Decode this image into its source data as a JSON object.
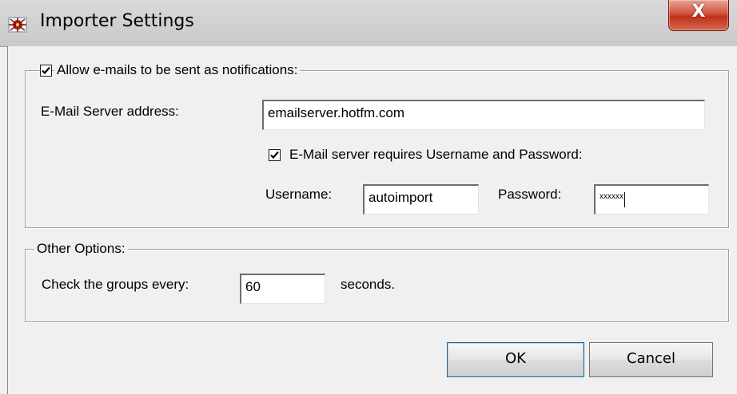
{
  "window": {
    "title": "Importer Settings",
    "close_glyph": "X",
    "icon": "importer-app-icon"
  },
  "notifications": {
    "allow_emails_label": "Allow e-mails to be sent as notifications:",
    "allow_emails_checked": true,
    "server_address_label": "E-Mail Server address:",
    "server_address_value": "emailserver.hotfm.com",
    "requires_auth_label": "E-Mail server  requires Username and Password:",
    "requires_auth_checked": true,
    "username_label": "Username:",
    "username_value": "autoimport",
    "password_label": "Password:",
    "password_value": "xxxxxx"
  },
  "other_options": {
    "group_label": "Other Options:",
    "check_groups_label": "Check the groups every:",
    "check_groups_value": "60",
    "seconds_label": "seconds."
  },
  "buttons": {
    "ok_label": "OK",
    "cancel_label": "Cancel"
  },
  "colors": {
    "titlebar": "#d0d0d0",
    "close_button": "#c7402a",
    "dialog_background": "#f0f0f0"
  }
}
